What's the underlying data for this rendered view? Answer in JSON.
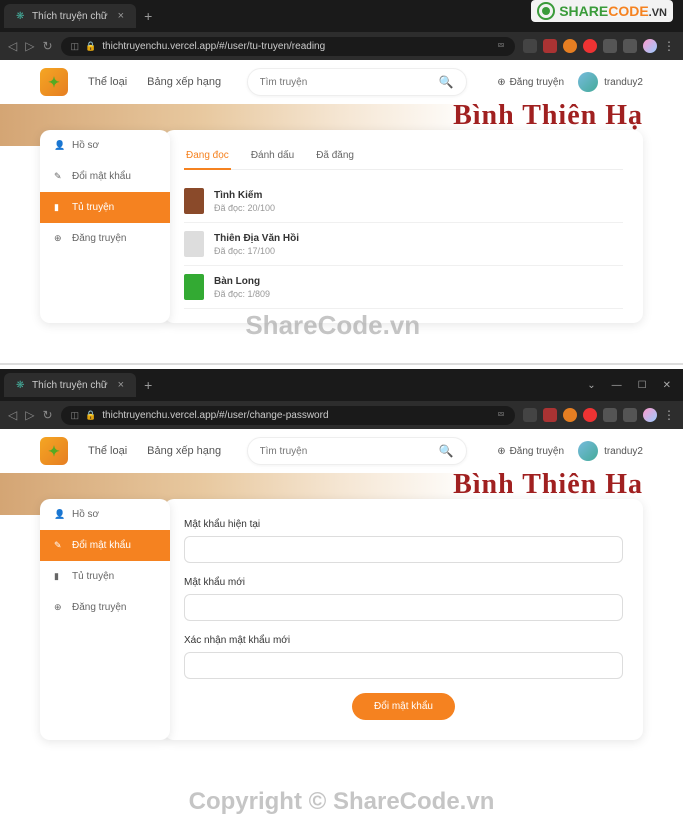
{
  "watermark": {
    "share": "SHARE",
    "code": "CODE",
    "vn": ".VN",
    "center": "ShareCode.vn",
    "copyright": "Copyright © ShareCode.vn"
  },
  "browser": {
    "tab_title": "Thích truyện chữ",
    "url1": "thichtruyenchu.vercel.app/#/user/tu-truyen/reading",
    "url2": "thichtruyenchu.vercel.app/#/user/change-password"
  },
  "header": {
    "nav1": "Thể loại",
    "nav2": "Bảng xếp hạng",
    "search_placeholder": "Tìm truyện",
    "post": "Đăng truyện",
    "username": "tranduy2"
  },
  "hero": {
    "title1": "Bình Thiên Hạ",
    "title2": "Bình Thiên Ha"
  },
  "sidebar": {
    "items": [
      {
        "label": "Hồ sơ"
      },
      {
        "label": "Đổi mật khẩu"
      },
      {
        "label": "Tủ truyện"
      },
      {
        "label": "Đăng truyện"
      }
    ]
  },
  "tabs": [
    {
      "label": "Đang đọc",
      "active": true
    },
    {
      "label": "Đánh dấu",
      "active": false
    },
    {
      "label": "Đã đăng",
      "active": false
    }
  ],
  "stories": [
    {
      "title": "Tình Kiếm",
      "progress": "Đã đọc: 20/100"
    },
    {
      "title": "Thiên Địa Văn Hồi",
      "progress": "Đã đọc: 17/100"
    },
    {
      "title": "Bàn Long",
      "progress": "Đã đọc: 1/809"
    }
  ],
  "form": {
    "current_label": "Mật khẩu hiện tại",
    "new_label": "Mật khẩu mới",
    "confirm_label": "Xác nhận mật khẩu mới",
    "submit": "Đổi mật khẩu"
  }
}
